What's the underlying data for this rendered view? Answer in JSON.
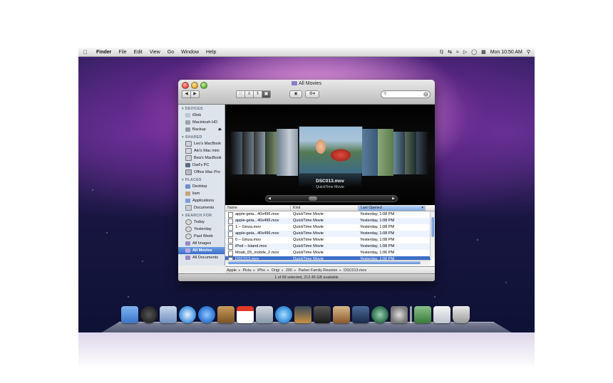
{
  "menubar": {
    "apple": "",
    "app": "Finder",
    "menus": [
      "File",
      "Edit",
      "View",
      "Go",
      "Window",
      "Help"
    ],
    "clock": "Mon 10:50 AM"
  },
  "window": {
    "title": "All Movies",
    "status": "1 of 69 selected, 212.45 GB available"
  },
  "sidebar": {
    "devices_header": "DEVICES",
    "devices": [
      "iDisk",
      "Macintosh HD",
      "Backup"
    ],
    "shared_header": "SHARED",
    "shared": [
      "Leo's MacBook",
      "Aki's Mac mini",
      "Bea's MacBook",
      "Dad's PC",
      "Office Mac Pro"
    ],
    "places_header": "PLACES",
    "places": [
      "Desktop",
      "liam",
      "Applications",
      "Documents"
    ],
    "search_header": "SEARCH FOR",
    "search": [
      "Today",
      "Yesterday",
      "Past Week",
      "All Images",
      "All Movies",
      "All Documents"
    ]
  },
  "coverflow": {
    "name": "DSC013.mov",
    "kind": "QuickTime Movie"
  },
  "list": {
    "headers": {
      "name": "Name",
      "kind": "Kind",
      "last_opened": "Last Opened"
    },
    "rows": [
      {
        "name": "apple-geta...40x496.mov",
        "kind": "QuickTime Movie",
        "date": "Yesterday, 1:08 PM"
      },
      {
        "name": "apple-geta...40x496.mov",
        "kind": "QuickTime Movie",
        "date": "Yesterday, 1:08 PM"
      },
      {
        "name": "1 – Ginza.mov",
        "kind": "QuickTime Movie",
        "date": "Yesterday, 1:08 PM"
      },
      {
        "name": "apple-geta...40x496.mov",
        "kind": "QuickTime Movie",
        "date": "Yesterday, 1:08 PM"
      },
      {
        "name": "0 – Ginza.mov",
        "kind": "QuickTime Movie",
        "date": "Yesterday, 1:08 PM"
      },
      {
        "name": "iPod – Island.mov",
        "kind": "QuickTime Movie",
        "date": "Yesterday, 1:08 PM"
      },
      {
        "name": "Moab_05_mobile_2.mov",
        "kind": "QuickTime Movie",
        "date": "Yesterday, 1:06 PM"
      },
      {
        "name": "DSC013.mov",
        "kind": "QuickTime Movie",
        "date": "Yesterday, 1:06 PM"
      }
    ]
  },
  "pathbar": [
    "Apple",
    "Pictu",
    "iPho",
    "Origi",
    "200",
    "Parker Family Reunion",
    "DSC013.mov"
  ],
  "colors": {
    "selection": "#3d6ec8",
    "sidebar_bg": "#dde4ec",
    "accent": "#6f9fe0"
  },
  "dock_icons": [
    "finder-icon",
    "dashboard-icon",
    "mail-icon",
    "safari-icon",
    "ichat-icon",
    "address-book-icon",
    "ical-icon",
    "preview-icon",
    "itunes-icon",
    "iphoto-icon",
    "imovie-icon",
    "garageband-icon",
    "spaces-icon",
    "time-machine-icon",
    "system-preferences-icon",
    "photo-stack-icon",
    "documents-stack-icon",
    "trash-icon"
  ]
}
